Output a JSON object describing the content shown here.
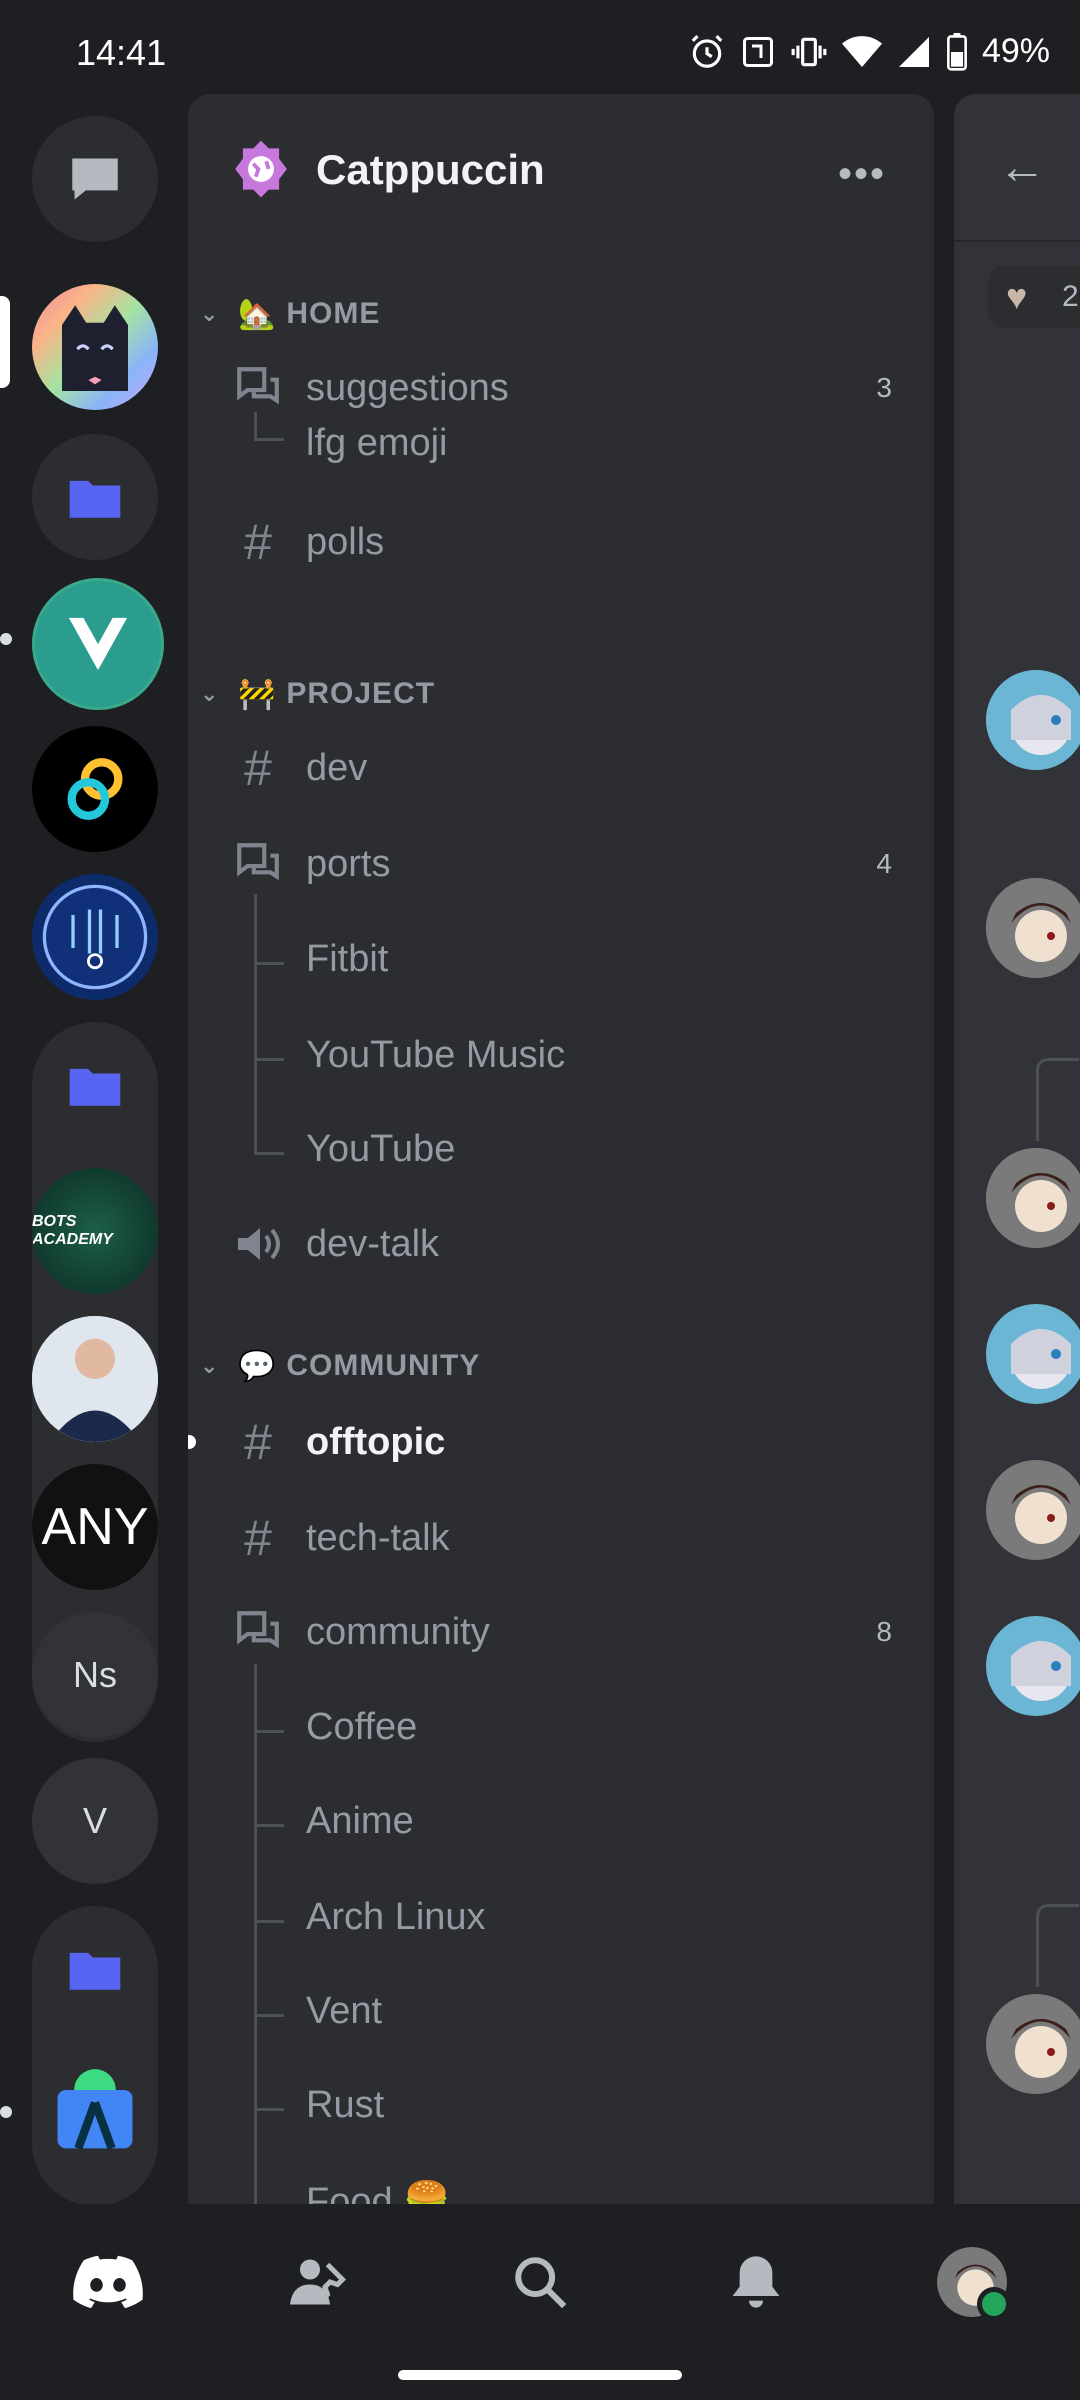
{
  "status_bar": {
    "time": "14:41",
    "battery": "49%"
  },
  "guild": {
    "name": "Catppuccin",
    "more_label": "•••"
  },
  "categories": {
    "home": {
      "emoji": "🏡",
      "label": "HOME"
    },
    "project": {
      "emoji": "🚧",
      "label": "PROJECT"
    },
    "community": {
      "emoji": "💬",
      "label": "COMMUNITY"
    }
  },
  "channels": {
    "suggestions": {
      "name": "suggestions",
      "count": "3"
    },
    "lfg_emoji": {
      "name": "lfg emoji"
    },
    "polls": {
      "name": "polls"
    },
    "dev": {
      "name": "dev"
    },
    "ports": {
      "name": "ports",
      "count": "4"
    },
    "fitbit": {
      "name": "Fitbit"
    },
    "youtube_music": {
      "name": "YouTube Music"
    },
    "youtube": {
      "name": "YouTube"
    },
    "dev_talk": {
      "name": "dev-talk"
    },
    "offtopic": {
      "name": "offtopic"
    },
    "tech_talk": {
      "name": "tech-talk"
    },
    "community": {
      "name": "community",
      "count": "8"
    },
    "coffee": {
      "name": "Coffee"
    },
    "anime": {
      "name": "Anime"
    },
    "arch_linux": {
      "name": "Arch Linux"
    },
    "vent": {
      "name": "Vent"
    },
    "rust": {
      "name": "Rust"
    },
    "food": {
      "name": "Food 🍔"
    }
  },
  "servers": {
    "any_label": "ANY",
    "ns_label": "Ns",
    "v_label": "V",
    "bots_academy_label": "BOTS ACADEMY"
  },
  "peek": {
    "reaction_count": "2"
  },
  "colors": {
    "accent": "#5865f2",
    "catppuccin": "#c678dd"
  }
}
